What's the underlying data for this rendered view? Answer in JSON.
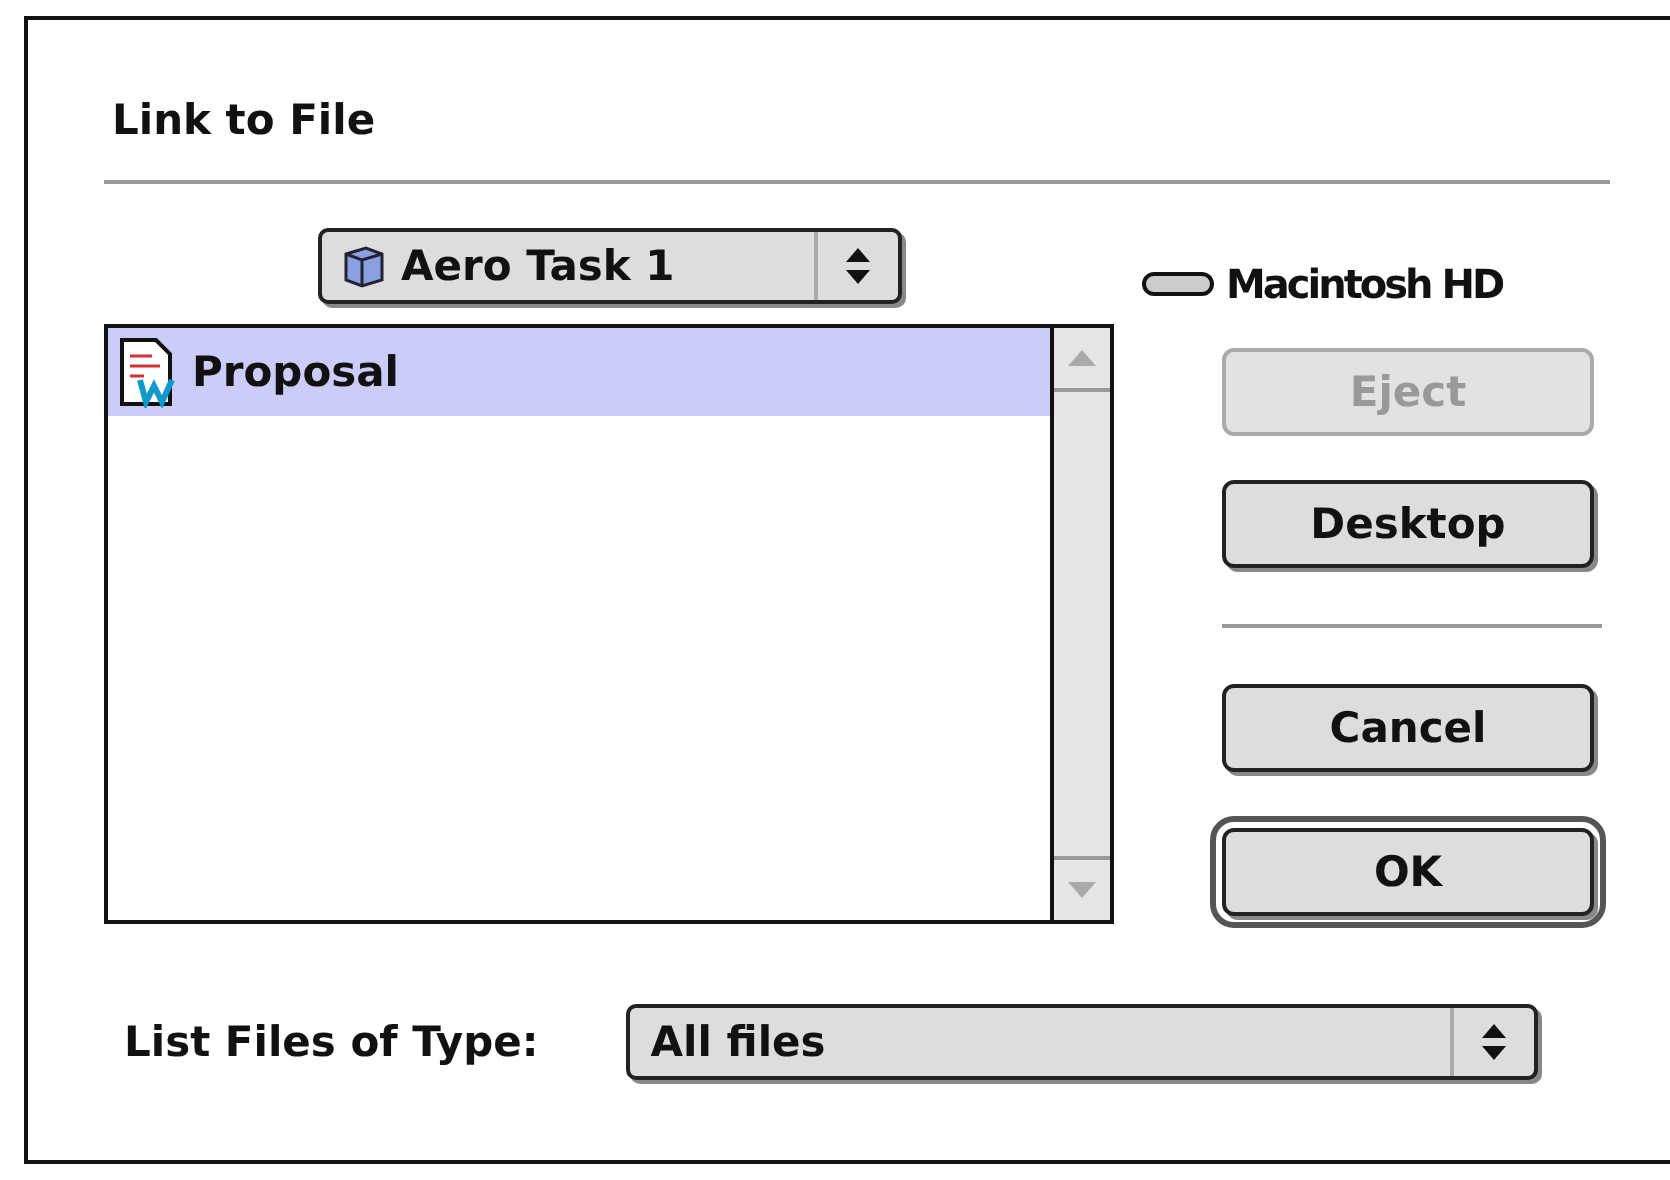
{
  "window": {
    "title": "Link to File"
  },
  "folder_popup": {
    "label": "Aero Task 1"
  },
  "volume": {
    "name": "Macintosh HD"
  },
  "files": [
    {
      "name": "Proposal",
      "selected": true
    }
  ],
  "buttons": [
    {
      "label": "Eject",
      "disabled": true,
      "default": false
    },
    {
      "label": "Desktop",
      "disabled": false,
      "default": false
    },
    {
      "label": "Cancel",
      "disabled": false,
      "default": false
    },
    {
      "label": "OK",
      "disabled": false,
      "default": true
    }
  ],
  "file_type": {
    "label": "List Files of Type:",
    "value": "All files"
  }
}
